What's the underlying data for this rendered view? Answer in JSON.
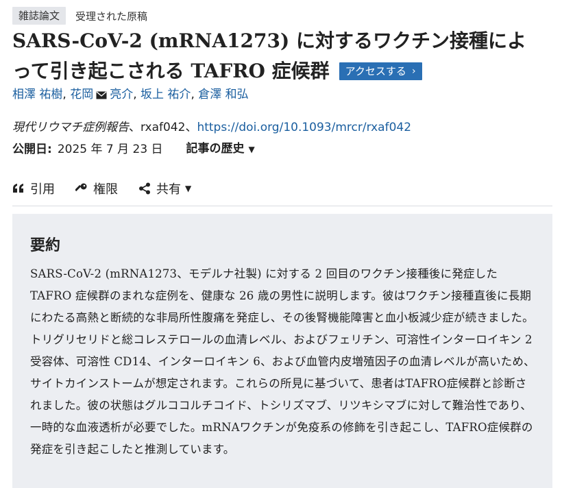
{
  "header": {
    "badge": "雑誌論文",
    "status": "受理された原稿"
  },
  "article": {
    "title": "SARS-CoV-2 (mRNA1273) に対するワクチン接種によって引き起こされる TAFRO 症候群",
    "access_label": "アクセスする"
  },
  "authors": [
    {
      "name": "相澤 祐樹",
      "email": false
    },
    {
      "name": "花岡",
      "email": true
    },
    {
      "name": "亮介",
      "email": false
    },
    {
      "name": "坂上 祐介",
      "email": false
    },
    {
      "name": "倉澤 和弘",
      "email": false
    }
  ],
  "citation": {
    "journal": "現代リウマチ症例報告",
    "article_id": "、rxaf042、",
    "doi": "https://doi.org/10.1093/mrcr/rxaf042"
  },
  "publication": {
    "label": "公開日:",
    "date": "2025 年 7 月 23 日",
    "history_label": "記事の歴史"
  },
  "tools": {
    "cite": "引用",
    "permissions": "権限",
    "share": "共有"
  },
  "abstract": {
    "heading": "要約",
    "text": "SARS-CoV-2 (mRNA1273、モデルナ社製) に対する 2 回目のワクチン接種後に発症した TAFRO 症候群のまれな症例を、健康な 26 歳の男性に説明します。彼はワクチン接種直後に長期にわたる高熱と断続的な非局所性腹痛を発症し、その後腎機能障害と血小板減少症が続きました。トリグリセリドと総コレステロールの血清レベル、およびフェリチン、可溶性インターロイキン 2 受容体、可溶性 CD14、インターロイキン 6、および血管内皮増殖因子の血清レベルが高いため、サイトカインストームが想定されます。これらの所見に基づいて、患者はTAFRO症候群と診断されました。彼の状態はグルココルチコイド、トシリズマブ、リツキシマブに対して難治性であり、一時的な血液透析が必要でした。mRNAワクチンが免疫系の修飾を引き起こし、TAFRO症候群の発症を引き起こしたと推測しています。"
  },
  "colors": {
    "link": "#1a5e9f",
    "access_button": "#2a6fb4",
    "abstract_bg": "#eceef2",
    "badge_bg": "#e4e6ea"
  },
  "icons": [
    "quote-icon",
    "key-icon",
    "share-icon",
    "envelope-icon",
    "chevron-right-icon",
    "caret-down-icon"
  ]
}
